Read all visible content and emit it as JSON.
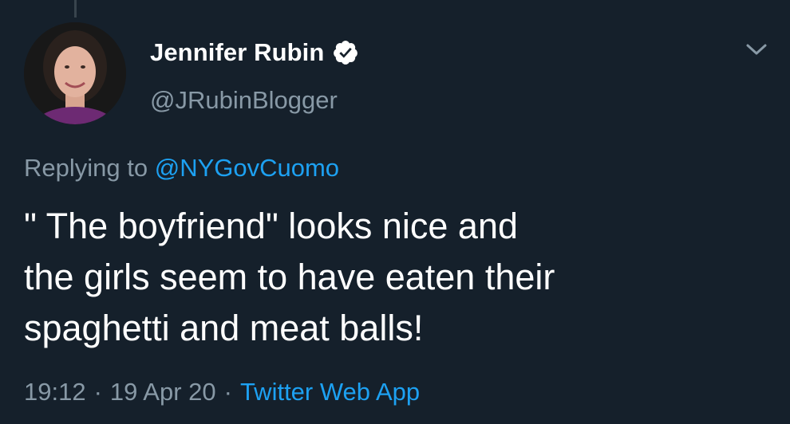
{
  "tweet": {
    "display_name": "Jennifer Rubin",
    "handle": "@JRubinBlogger",
    "verified": true,
    "reply_prefix": "Replying to",
    "reply_to": "@NYGovCuomo",
    "text": "\" The boyfriend\" looks nice and\nthe girls seem to have eaten their\nspaghetti and meat balls!",
    "time": "19:12",
    "date": "19 Apr 20",
    "source": "Twitter Web App",
    "separator": "·"
  },
  "icons": {
    "verified": "verified-badge-icon",
    "menu": "chevron-down-icon"
  },
  "colors": {
    "background": "#15202b",
    "primary_text": "#ffffff",
    "secondary_text": "#8899a6",
    "link": "#1da1f2"
  }
}
